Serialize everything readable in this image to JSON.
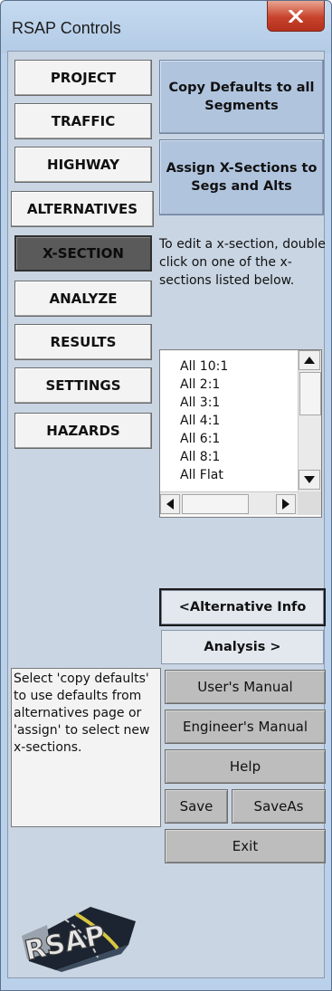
{
  "window": {
    "title": "RSAP Controls"
  },
  "nav": {
    "items": [
      {
        "label": "PROJECT"
      },
      {
        "label": "TRAFFIC"
      },
      {
        "label": "HIGHWAY"
      },
      {
        "label": "ALTERNATIVES"
      },
      {
        "label": "X-SECTION",
        "active": true
      },
      {
        "label": "ANALYZE"
      },
      {
        "label": "RESULTS"
      },
      {
        "label": "SETTINGS"
      },
      {
        "label": "HAZARDS"
      }
    ]
  },
  "actions": {
    "copy_defaults": "Copy Defaults to all Segments",
    "assign_xsections": "Assign X-Sections to Segs and Alts"
  },
  "instructions": "To edit a x-section, double click on one of the x-sections listed below.",
  "xsection_list": {
    "items": [
      "All 10:1",
      "All 2:1",
      "All 3:1",
      "All 4:1",
      "All 6:1",
      "All 8:1",
      "All Flat"
    ]
  },
  "navigation": {
    "prev_label": "<Alternative Info",
    "next_label": "Analysis >"
  },
  "help_note": "Select 'copy defaults' to use defaults from alternatives page or 'assign' to select new x-sections.",
  "tools": {
    "users_manual": "User's Manual",
    "engineers_manual": "Engineer's Manual",
    "help": "Help",
    "save": "Save",
    "save_as": "SaveAs",
    "exit": "Exit"
  },
  "logo": {
    "text": "RSAP"
  },
  "colors": {
    "client_bg": "#c9d5e3",
    "blue_button": "#b0c4de",
    "active_nav": "#5a5a5a",
    "gray_button": "#bdbdbd",
    "close_red": "#c8432c"
  },
  "icons": {
    "close": "close-x-icon",
    "scroll_up": "triangle-up-icon",
    "scroll_down": "triangle-down-icon",
    "scroll_left": "triangle-left-icon",
    "scroll_right": "triangle-right-icon"
  }
}
